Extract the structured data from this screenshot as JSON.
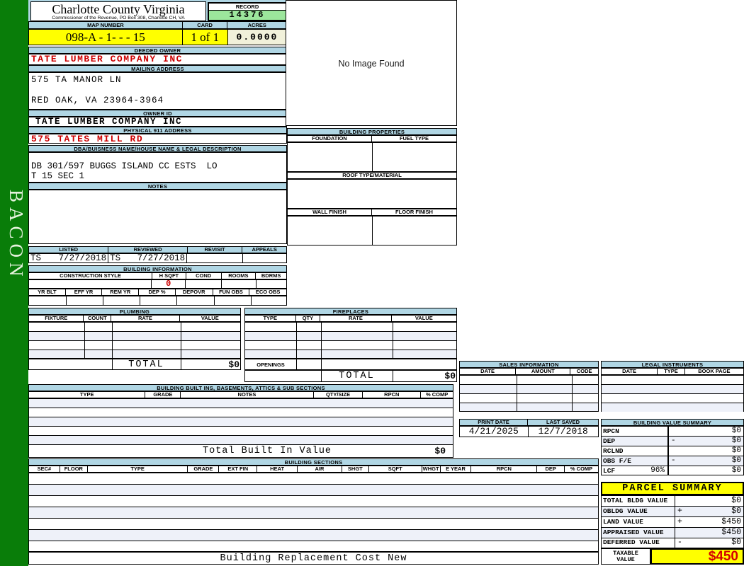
{
  "colors": {
    "banner_blue": "#b0d6e4",
    "record_green": "#9ce69c",
    "highlight_yellow": "#ffff00",
    "acres_beige": "#f1f1da",
    "sidebar_green": "#097d09",
    "alert_red": "#cc0000",
    "row_stripe": "#eef1f9"
  },
  "sidebar": {
    "label": "BACON"
  },
  "header": {
    "county": "Charlotte County Virginia",
    "commissioner": "Commissioner of the Revenue, PO Box 308, Charlotte CH, VA",
    "record_label": "RECORD",
    "record_value": "14376",
    "map_number_label": "MAP NUMBER",
    "map_number": "098-A - 1-  -  - 15",
    "card_label": "CARD",
    "card_value": "1 of 1",
    "acres_label": "ACRES",
    "acres_value": "0.0000"
  },
  "owner": {
    "deeded_owner_label": "DEEDED OWNER",
    "deeded_owner": "TATE LUMBER COMPANY INC",
    "mailing_address_label": "MAILING ADDRESS",
    "mailing_line1": "575 TA MANOR LN",
    "mailing_line2": "RED OAK, VA 23964-3964",
    "owner_id_label": "OWNER ID",
    "owner_id": "TATE LUMBER COMPANY INC",
    "physical_address_label": "PHYSICAL 911 ADDRESS",
    "physical_address": "575 TATES MILL RD",
    "dba_label": "DBA/BUISNESS NAME/HOUSE NAME & LEGAL DESCRIPTION",
    "legal_line1": "DB 301/597 BUGGS ISLAND CC ESTS  LO",
    "legal_line2": "T 15 SEC 1",
    "notes_label": "NOTES"
  },
  "image_panel": {
    "no_image_text": "No Image Found"
  },
  "building_properties": {
    "title": "BUILDING PROPERTIES",
    "foundation_label": "FOUNDATION",
    "fuel_type_label": "FUEL TYPE",
    "roof_label": "ROOF TYPE/MATERIAL",
    "wall_label": "WALL FINISH",
    "floor_label": "FLOOR FINISH"
  },
  "review": {
    "listed_label": "LISTED",
    "listed_by": "TS",
    "listed_date": "7/27/2018",
    "reviewed_label": "REVIEWED",
    "reviewed_by": "TS",
    "reviewed_date": "7/27/2018",
    "revisit_label": "REVISIT",
    "appeals_label": "APPEALS"
  },
  "building_information": {
    "title": "BUILDING INFORMATION",
    "construction_style_label": "CONSTRUCTION STYLE",
    "hsqft_label": "H SQFT",
    "hsqft_value": "0",
    "cond_label": "COND",
    "rooms_label": "ROOMS",
    "bdrms_label": "BDRMS",
    "year_headers": [
      "YR BLT",
      "EFF YR",
      "REM YR",
      "DEP %",
      "DEPOVR",
      "FUN OBS",
      "ECO OBS"
    ]
  },
  "plumbing": {
    "title": "PLUMBING",
    "headers": [
      "FIXTURE",
      "COUNT",
      "RATE",
      "VALUE"
    ],
    "total_label": "TOTAL",
    "total_value": "$0"
  },
  "fireplaces": {
    "title": "FIREPLACES",
    "headers": [
      "TYPE",
      "QTY",
      "RATE",
      "VALUE"
    ],
    "openings_label": "OPENINGS",
    "total_label": "TOTAL",
    "total_value": "$0"
  },
  "built_ins": {
    "title": "BUILDING BUILT INS, BASEMENTS, ATTICS & SUB SECTIONS",
    "headers": [
      "TYPE",
      "GRADE",
      "NOTES",
      "QTY/SIZE",
      "RPCN",
      "% COMP"
    ],
    "total_label": "Total Built In Value",
    "total_value": "$0"
  },
  "building_sections": {
    "title": "BUILDING SECTIONS",
    "headers": [
      "SEC#",
      "FLOOR",
      "TYPE",
      "GRADE",
      "EXT FIN",
      "HEAT",
      "AIR",
      "SHGT",
      "SQFT",
      "WHGT",
      "E YEAR",
      "RPCN",
      "DEP",
      "% COMP"
    ],
    "footer": "Building Replacement Cost New"
  },
  "sales": {
    "title": "SALES INFORMATION",
    "headers": [
      "DATE",
      "AMOUNT",
      "CODE"
    ]
  },
  "legal_instruments": {
    "title": "LEGAL INSTRUMENTS",
    "headers": [
      "DATE",
      "TYPE",
      "BOOK PAGE"
    ]
  },
  "dates": {
    "print_date_label": "PRINT DATE",
    "print_date": "4/21/2025",
    "last_saved_label": "LAST SAVED",
    "last_saved": "12/7/2018"
  },
  "building_value_summary": {
    "title": "BUILDING VALUE SUMMARY",
    "rows": [
      {
        "label": "RPCN",
        "pct": "",
        "op": "",
        "value": "$0"
      },
      {
        "label": "DEP",
        "pct": "",
        "op": "-",
        "value": "$0"
      },
      {
        "label": "RCLND",
        "pct": "",
        "op": "",
        "value": "$0"
      },
      {
        "label": "OBS F/E",
        "pct": "",
        "op": "-",
        "value": "$0"
      },
      {
        "label": "LCF",
        "pct": "96%",
        "op": "",
        "value": "$0"
      }
    ]
  },
  "parcel_summary": {
    "title": "PARCEL SUMMARY",
    "rows": [
      {
        "label": "TOTAL BLDG VALUE",
        "op": "",
        "value": "$0"
      },
      {
        "label": "OBLDG VALUE",
        "op": "+",
        "value": "$0"
      },
      {
        "label": "LAND VALUE",
        "op": "+",
        "value": "$450"
      },
      {
        "label": "APPRAISED VALUE",
        "op": "",
        "value": "$450"
      },
      {
        "label": "DEFERRED VALUE",
        "op": "-",
        "value": "$0"
      }
    ],
    "taxable_label": "TAXABLE VALUE",
    "taxable_value": "$450"
  }
}
